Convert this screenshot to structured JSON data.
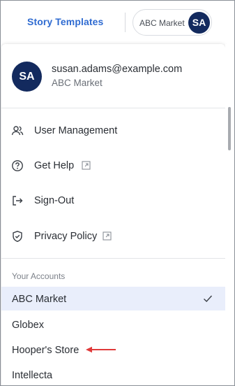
{
  "header": {
    "tab_label": "Story Templates",
    "account_pill_label": "ABC Market",
    "avatar_initials": "SA"
  },
  "user": {
    "initials": "SA",
    "email": "susan.adams@example.com",
    "organization": "ABC Market"
  },
  "menu": {
    "items": [
      {
        "label": "User Management",
        "icon": "users-icon",
        "external": false
      },
      {
        "label": "Get Help",
        "icon": "help-circle-icon",
        "external": true
      },
      {
        "label": "Sign-Out",
        "icon": "sign-out-icon",
        "external": false
      },
      {
        "label": "Privacy Policy",
        "icon": "shield-check-icon",
        "external": true
      }
    ]
  },
  "accounts": {
    "title": "Your Accounts",
    "items": [
      {
        "label": "ABC Market",
        "selected": true
      },
      {
        "label": "Globex",
        "selected": false
      },
      {
        "label": "Hooper's Store",
        "selected": false
      },
      {
        "label": "Intellecta",
        "selected": false
      }
    ]
  },
  "colors": {
    "accent": "#2f6bd1",
    "avatar_bg": "#132a5e",
    "selected_row_bg": "#e9eefb",
    "annotation_arrow": "#e03a3a"
  }
}
